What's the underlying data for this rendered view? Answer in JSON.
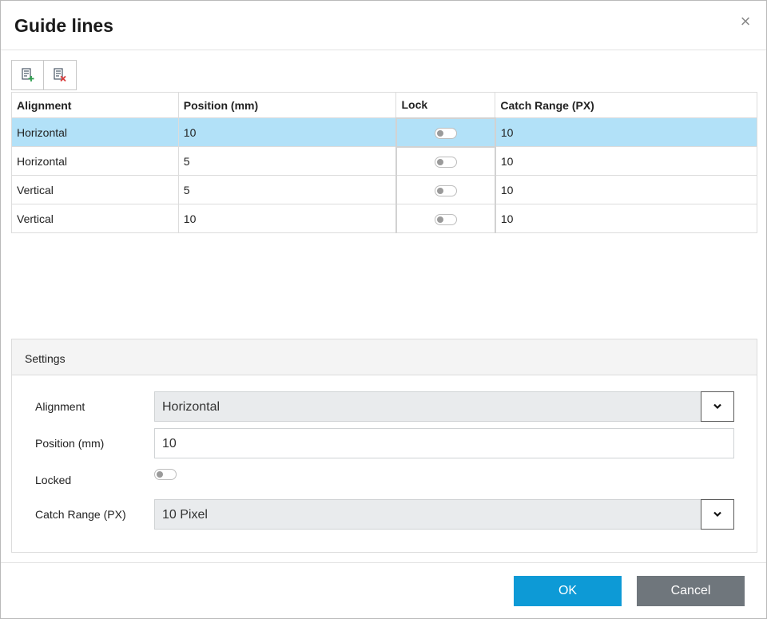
{
  "dialog": {
    "title": "Guide lines",
    "close_icon": "×"
  },
  "toolbar": {
    "buttons": [
      {
        "icon": "add-guide-line-icon"
      },
      {
        "icon": "delete-guide-line-icon"
      }
    ]
  },
  "table": {
    "columns": [
      "Alignment",
      "Position (mm)",
      "Lock",
      "Catch Range (PX)"
    ],
    "rows": [
      {
        "alignment": "Horizontal",
        "position": "10",
        "locked": false,
        "catch_range": "10",
        "selected": true
      },
      {
        "alignment": "Horizontal",
        "position": "5",
        "locked": false,
        "catch_range": "10",
        "selected": false
      },
      {
        "alignment": "Vertical",
        "position": "5",
        "locked": false,
        "catch_range": "10",
        "selected": false
      },
      {
        "alignment": "Vertical",
        "position": "10",
        "locked": false,
        "catch_range": "10",
        "selected": false
      }
    ]
  },
  "settings": {
    "title": "Settings",
    "alignment_label": "Alignment",
    "alignment_value": "Horizontal",
    "position_label": "Position (mm)",
    "position_value": "10",
    "locked_label": "Locked",
    "locked_value": false,
    "catch_range_label": "Catch Range (PX)",
    "catch_range_value": "10 Pixel"
  },
  "footer": {
    "ok_label": "OK",
    "cancel_label": "Cancel"
  },
  "colors": {
    "selected_row": "#b2e1f8",
    "ok_button": "#0d9ad6",
    "cancel_button": "#6f767c"
  }
}
